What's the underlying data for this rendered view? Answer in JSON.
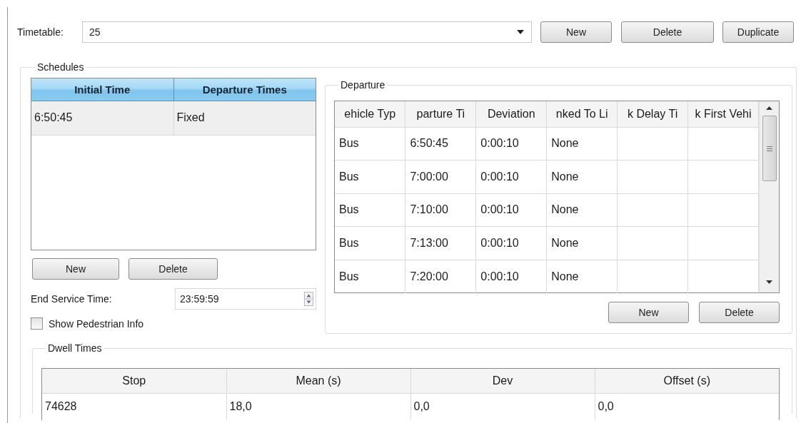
{
  "timetable": {
    "label": "Timetable:",
    "value": "25",
    "buttons": [
      "New",
      "Delete",
      "Duplicate"
    ]
  },
  "schedules": {
    "title": "Schedules",
    "columns": [
      "Initial Time",
      "Departure Times"
    ],
    "rows": [
      {
        "cells": [
          "6:50:45",
          "Fixed"
        ],
        "selected": true
      }
    ],
    "buttons": [
      "New",
      "Delete"
    ],
    "end_service": {
      "label": "End Service Time:",
      "value": "23:59:59"
    },
    "show_pedestrian": {
      "label": "Show Pedestrian Info",
      "checked": false
    }
  },
  "departure": {
    "title": "Departure",
    "columns": [
      "ehicle Typ",
      "parture Ti",
      "Deviation",
      "nked To Li",
      "k Delay Ti",
      "k First Vehi"
    ],
    "rows": [
      [
        "Bus",
        "6:50:45",
        "0:00:10",
        "None"
      ],
      [
        "Bus",
        "7:00:00",
        "0:00:10",
        "None"
      ],
      [
        "Bus",
        "7:10:00",
        "0:00:10",
        "None"
      ],
      [
        "Bus",
        "7:13:00",
        "0:00:10",
        "None"
      ],
      [
        "Bus",
        "7:20:00",
        "0:00:10",
        "None"
      ]
    ],
    "buttons": [
      "New",
      "Delete"
    ]
  },
  "dwell_times": {
    "title": "Dwell Times",
    "columns": [
      "Stop",
      "Mean (s)",
      "Dev",
      "Offset (s)"
    ],
    "rows": [
      [
        "74628",
        "18,0",
        "0,0",
        "0,0"
      ]
    ]
  }
}
